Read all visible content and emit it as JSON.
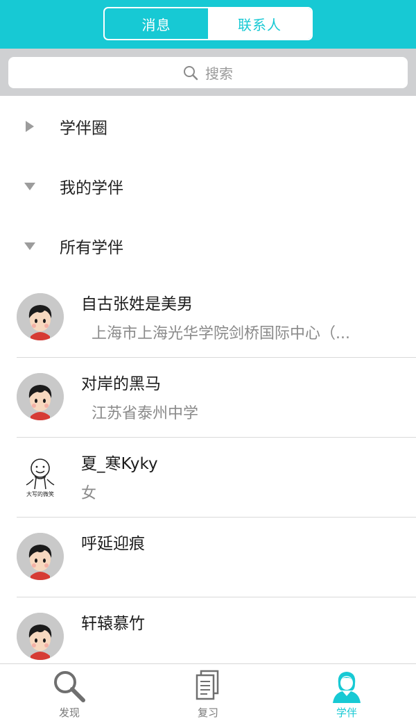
{
  "header": {
    "tabs": [
      {
        "label": "消息",
        "active": false
      },
      {
        "label": "联系人",
        "active": true
      }
    ],
    "accent_color": "#17c9d4"
  },
  "search": {
    "placeholder": "搜索",
    "icon": "search-icon"
  },
  "groups": [
    {
      "label": "学伴圈",
      "state": "collapsed"
    },
    {
      "label": "我的学伴",
      "state": "expanded"
    },
    {
      "label": "所有学伴",
      "state": "expanded"
    }
  ],
  "contacts": [
    {
      "name": "自古张姓是美男",
      "subtitle": "上海市上海光华学院剑桥国际中心（...",
      "avatar": "cartoon-boy-avatar"
    },
    {
      "name": "对岸的黑马",
      "subtitle": "江苏省泰州中学",
      "avatar": "cartoon-boy-avatar"
    },
    {
      "name": "夏_寒Kyky",
      "subtitle": "女",
      "avatar": "smiley-sketch-avatar",
      "avatar_caption": "大写的微笑"
    },
    {
      "name": "呼延迎痕",
      "subtitle": "",
      "avatar": "cartoon-boy-avatar"
    },
    {
      "name": "轩辕慕竹",
      "subtitle": "",
      "avatar": "cartoon-boy-avatar"
    }
  ],
  "tabbar": [
    {
      "label": "发现",
      "icon": "magnifier-icon",
      "active": false
    },
    {
      "label": "复习",
      "icon": "documents-icon",
      "active": false
    },
    {
      "label": "学伴",
      "icon": "person-icon",
      "active": true
    }
  ]
}
